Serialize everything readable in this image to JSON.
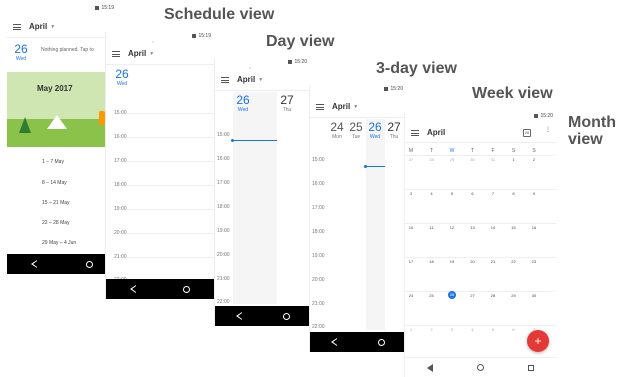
{
  "titles": {
    "schedule": "Schedule view",
    "day": "Day view",
    "three_day": "3-day view",
    "week": "Week view",
    "month_line1": "Month",
    "month_line2": "view"
  },
  "schedule": {
    "time": "15:19",
    "month": "April",
    "today_num": "26",
    "today_day": "Wed",
    "nothing_planned": "Nothing planned. Tap to",
    "banner_label": "May 2017",
    "weeks": [
      "1 – 7 May",
      "8 – 14 May",
      "15 – 21 May",
      "22 – 28 May",
      "29 May – 4 Jun"
    ]
  },
  "day": {
    "time": "15:19",
    "month": "April",
    "day_num": "26",
    "day_name": "Wed",
    "hours": [
      "15:00",
      "16:00",
      "17:00",
      "18:00",
      "19:00",
      "20:00",
      "21:00",
      "22:00"
    ]
  },
  "threeday": {
    "time": "15:20",
    "month": "April",
    "days": [
      {
        "num": "26",
        "name": "Wed"
      },
      {
        "num": "27",
        "name": "Thu"
      }
    ],
    "hours": [
      "15:00",
      "16:00",
      "17:00",
      "18:00",
      "19:00",
      "20:00",
      "21:00",
      "22:00",
      "23:00"
    ]
  },
  "week": {
    "time": "15:20",
    "month": "April",
    "days": [
      {
        "num": "24",
        "name": "Mon"
      },
      {
        "num": "25",
        "name": "Tue"
      },
      {
        "num": "26",
        "name": "Wed"
      },
      {
        "num": "27",
        "name": "Thu"
      }
    ],
    "hours": [
      "15:00",
      "16:00",
      "17:00",
      "18:00",
      "19:00",
      "20:00",
      "21:00",
      "22:00"
    ]
  },
  "monthview": {
    "time": "15:20",
    "month": "April",
    "dow": [
      "M",
      "T",
      "W",
      "T",
      "F",
      "S",
      "S"
    ],
    "rows": [
      [
        "27",
        "28",
        "29",
        "30",
        "31",
        "1",
        "2"
      ],
      [
        "3",
        "4",
        "5",
        "6",
        "7",
        "8",
        "9"
      ],
      [
        "10",
        "11",
        "12",
        "13",
        "14",
        "15",
        "16"
      ],
      [
        "17",
        "18",
        "19",
        "20",
        "21",
        "22",
        "23"
      ],
      [
        "24",
        "25",
        "26",
        "27",
        "28",
        "29",
        "30"
      ],
      [
        "1",
        "2",
        "3",
        "4",
        "5",
        "6",
        "7"
      ]
    ],
    "fab": "+"
  },
  "colors": {
    "accent": "#1a73e8",
    "fab": "#e53935"
  }
}
